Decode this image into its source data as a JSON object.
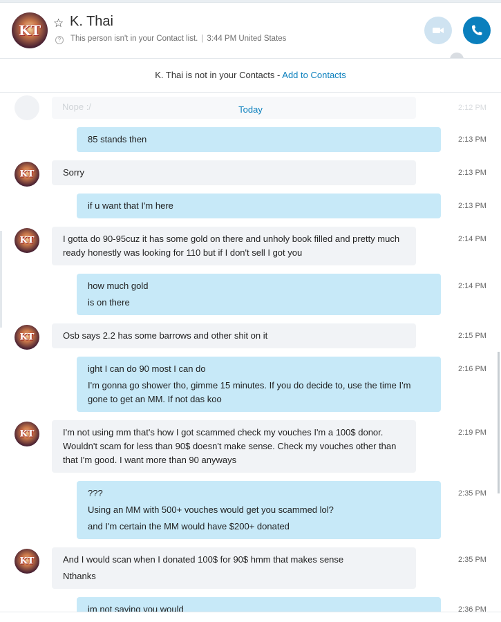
{
  "contact": {
    "name": "K. Thai",
    "avatar_initials": "KT",
    "status_note": "This person isn't in your Contact list.",
    "local_time": "3:44 PM United States",
    "help_glyph": "?"
  },
  "header": {
    "video_call_icon": "video-camera-icon",
    "audio_call_icon": "phone-icon"
  },
  "banner": {
    "text": "K. Thai is not in your Contacts",
    "separator": "-",
    "add_link": "Add to Contacts"
  },
  "chat": {
    "date_divider": "Today",
    "faded_message": "Nope :/",
    "faded_time": "2:12 PM",
    "messages": [
      {
        "dir": "out",
        "time": "2:13 PM",
        "lines": [
          "85 stands then"
        ]
      },
      {
        "dir": "in",
        "time": "2:13 PM",
        "lines": [
          "Sorry"
        ]
      },
      {
        "dir": "out",
        "time": "2:13 PM",
        "lines": [
          "if u want that I'm here"
        ]
      },
      {
        "dir": "in",
        "time": "2:14 PM",
        "lines": [
          "I gotta do 90-95cuz it has some gold on there and unholy book filled and pretty much ready honestly was looking for 110 but if I don't sell I got you"
        ]
      },
      {
        "dir": "out",
        "time": "2:14 PM",
        "lines": [
          "how much gold",
          "is on there"
        ]
      },
      {
        "dir": "in",
        "time": "2:15 PM",
        "lines": [
          "Osb says 2.2 has some barrows and other shit on it"
        ]
      },
      {
        "dir": "out",
        "time": "2:16 PM",
        "lines": [
          "ight I can do 90 most I can do",
          "I'm gonna go shower tho, gimme 15 minutes. If you do decide to, use the time I'm gone to get an MM. If not das koo"
        ]
      },
      {
        "dir": "in",
        "time": "2:19 PM",
        "lines": [
          "I'm not using mm that's how I got scammed check my vouches I'm a 100$ donor. Wouldn't scam for less than 90$ doesn't make sense. Check my vouches other than that I'm good. I want more than 90 anyways"
        ]
      },
      {
        "dir": "out",
        "time": "2:35 PM",
        "lines": [
          "???",
          "Using an MM with 500+ vouches would  get you scammed lol?",
          "and I'm certain the MM would have $200+ donated"
        ]
      },
      {
        "dir": "in",
        "time": "2:35 PM",
        "lines": [
          "And I would scan when I donated 100$ for 90$ hmm that makes sense",
          "Nthanks"
        ]
      },
      {
        "dir": "out",
        "time": "2:36 PM",
        "lines": [
          "im not saying you would"
        ]
      }
    ]
  }
}
